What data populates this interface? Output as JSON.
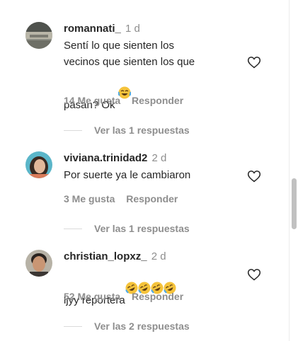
{
  "comments": [
    {
      "username": "romannati_",
      "time": "1 d",
      "text": "Sentí lo que sienten los\nvecinos que sienten los que\npasan? Ok",
      "emoji": [
        "laughing-tears-emoji"
      ],
      "likes": "14 Me gusta",
      "reply": "Responder",
      "replies": "Ver las 1 respuestas"
    },
    {
      "username": "viviana.trinidad2",
      "time": "2 d",
      "text": "Por suerte ya le cambiaron",
      "emoji": [],
      "likes": "3 Me gusta",
      "reply": "Responder",
      "replies": "Ver las 1 respuestas"
    },
    {
      "username": "christian_lopxz_",
      "time": "2 d",
      "text": "ljyy reportera",
      "emoji": [
        "rofl-emoji",
        "rofl-emoji",
        "rofl-emoji",
        "rofl-emoji"
      ],
      "likes": "52 Me gusta",
      "reply": "Responder",
      "replies": "Ver las 2 respuestas"
    }
  ],
  "colors": {
    "text": "#262626",
    "muted": "#8e8e8e",
    "divider": "#dbdbdb"
  }
}
